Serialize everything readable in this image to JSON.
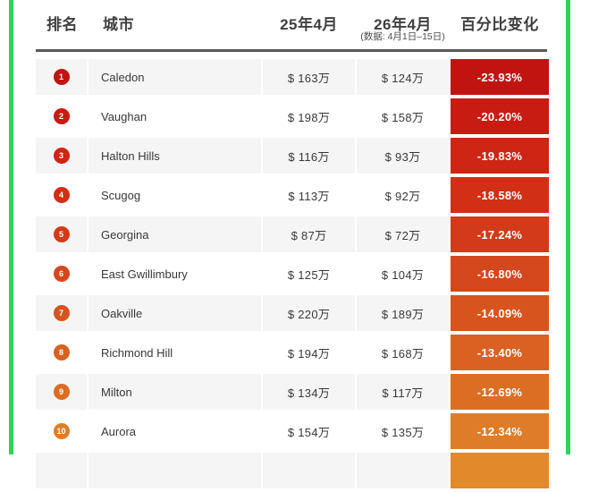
{
  "page": {
    "border_color": "#2fd35a",
    "divider_color": "#58585a",
    "alt_row_color": "#f5f5f6"
  },
  "header": {
    "rank_label": "排名",
    "city_label": "城市",
    "col_2025_label": "25年4月",
    "col_2026_label": "26年4月",
    "note": "(数据: 4月1日–15日)",
    "pct_label": "百分比变化"
  },
  "table": {
    "rows": [
      {
        "rank": "1",
        "city": "Caledon",
        "apr_2025": "$ 163万",
        "apr_2026": "$ 124万",
        "change": "-23.93%",
        "color": "#c11411"
      },
      {
        "rank": "2",
        "city": "Vaughan",
        "apr_2025": "$ 198万",
        "apr_2026": "$ 158万",
        "change": "-20.20%",
        "color": "#c81c12"
      },
      {
        "rank": "3",
        "city": "Halton Hills",
        "apr_2025": "$ 116万",
        "apr_2026": "$ 93万",
        "change": "-19.83%",
        "color": "#ce2514"
      },
      {
        "rank": "4",
        "city": "Scugog",
        "apr_2025": "$ 113万",
        "apr_2026": "$ 92万",
        "change": "-18.58%",
        "color": "#d12f16"
      },
      {
        "rank": "5",
        "city": "Georgina",
        "apr_2025": "$ 87万",
        "apr_2026": "$ 72万",
        "change": "-17.24%",
        "color": "#d33a19"
      },
      {
        "rank": "6",
        "city": "East Gwillimbury",
        "apr_2025": "$ 125万",
        "apr_2026": "$ 104万",
        "change": "-16.80%",
        "color": "#d5471c"
      },
      {
        "rank": "7",
        "city": "Oakville",
        "apr_2025": "$ 220万",
        "apr_2026": "$ 189万",
        "change": "-14.09%",
        "color": "#d8541f"
      },
      {
        "rank": "8",
        "city": "Richmond Hill",
        "apr_2025": "$ 194万",
        "apr_2026": "$ 168万",
        "change": "-13.40%",
        "color": "#da6121"
      },
      {
        "rank": "9",
        "city": "Milton",
        "apr_2025": "$ 134万",
        "apr_2026": "$ 117万",
        "change": "-12.69%",
        "color": "#dc6e24"
      },
      {
        "rank": "10",
        "city": "Aurora",
        "apr_2025": "$ 154万",
        "apr_2026": "$ 135万",
        "change": "-12.34%",
        "color": "#df7c28"
      }
    ],
    "partial_row": {
      "color": "#e1892b"
    }
  },
  "chart_data": {
    "type": "table",
    "title": "",
    "columns": [
      "排名",
      "城市",
      "25年4月",
      "26年4月",
      "百分比变化"
    ],
    "subnote": "(数据: 4月1日–15日)",
    "rows": [
      [
        1,
        "Caledon",
        163,
        124,
        -23.93
      ],
      [
        2,
        "Vaughan",
        198,
        158,
        -20.2
      ],
      [
        3,
        "Halton Hills",
        116,
        93,
        -19.83
      ],
      [
        4,
        "Scugog",
        113,
        92,
        -18.58
      ],
      [
        5,
        "Georgina",
        87,
        72,
        -17.24
      ],
      [
        6,
        "East Gwillimbury",
        125,
        104,
        -16.8
      ],
      [
        7,
        "Oakville",
        220,
        189,
        -14.09
      ],
      [
        8,
        "Richmond Hill",
        194,
        168,
        -13.4
      ],
      [
        9,
        "Milton",
        134,
        117,
        -12.69
      ],
      [
        10,
        "Aurora",
        154,
        135,
        -12.34
      ]
    ],
    "units": {
      "prices": "万 (CAD $10k)",
      "change": "%"
    }
  }
}
